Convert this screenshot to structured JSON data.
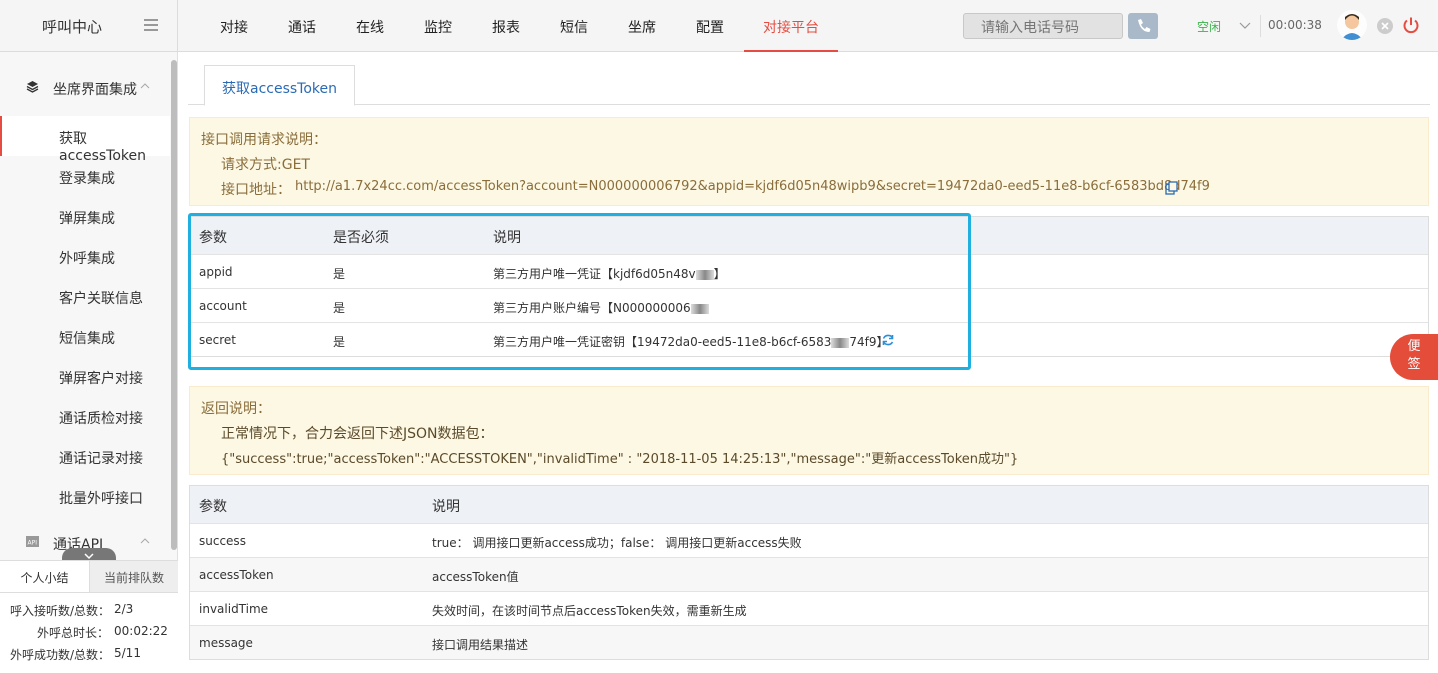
{
  "app": {
    "title": "呼叫中心"
  },
  "nav": {
    "items": [
      {
        "label": "对接"
      },
      {
        "label": "通话"
      },
      {
        "label": "在线"
      },
      {
        "label": "监控"
      },
      {
        "label": "报表"
      },
      {
        "label": "短信"
      },
      {
        "label": "坐席"
      },
      {
        "label": "配置"
      },
      {
        "label": "对接平台"
      }
    ],
    "active": "对接平台"
  },
  "header": {
    "phone_placeholder": "请输入电话号码",
    "status": "空闲",
    "timer": "00:00:38"
  },
  "sidebar": {
    "group1": "坐席界面集成",
    "items": [
      {
        "label": "获取accessToken"
      },
      {
        "label": "登录集成"
      },
      {
        "label": "弹屏集成"
      },
      {
        "label": "外呼集成"
      },
      {
        "label": "客户关联信息"
      },
      {
        "label": "短信集成"
      },
      {
        "label": "弹屏客户对接"
      },
      {
        "label": "通话质检对接"
      },
      {
        "label": "通话记录对接"
      },
      {
        "label": "批量外呼接口"
      }
    ],
    "group2": "通话API"
  },
  "summary": {
    "tabs": [
      "个人小结",
      "当前排队数"
    ],
    "rows": [
      {
        "label": "呼入接听数/总数：",
        "value": "2/3"
      },
      {
        "label": "外呼总时长：",
        "value": "00:02:22"
      },
      {
        "label": "外呼成功数/总数：",
        "value": "5/11"
      }
    ]
  },
  "main": {
    "tab": "获取accessToken",
    "request": {
      "title": "接口调用请求说明：",
      "method": "请求方式:GET",
      "url_label": "接口地址：",
      "url": "http://a1.7x24cc.com/accessToken?account=N000000006792&appid=kjdf6d05n48wipb9&secret=19472da0-eed5-11e8-b6cf-6583bd8d74f9"
    },
    "params": {
      "headers": [
        "参数",
        "是否必须",
        "说明"
      ],
      "rows": [
        {
          "name": "appid",
          "required": "是",
          "desc": "第三方用户唯一凭证【kjdf6d05n48v",
          "desc_end": "】"
        },
        {
          "name": "account",
          "required": "是",
          "desc": "第三方用户账户编号【N000000006",
          "desc_end": ""
        },
        {
          "name": "secret",
          "required": "是",
          "desc": "第三方用户唯一凭证密钥【19472da0-eed5-11e8-b6cf-6583",
          "desc_end": "74f9】"
        }
      ]
    },
    "response": {
      "title": "返回说明：",
      "desc": "正常情况下，合力会返回下述JSON数据包：",
      "json": "{\"success\":true;\"accessToken\":\"ACCESSTOKEN\",\"invalidTime\" : \"2018-11-05 14:25:13\",\"message\":\"更新accessToken成功\"}"
    },
    "fields": {
      "headers": [
        "参数",
        "说明"
      ],
      "rows": [
        {
          "name": "success",
          "desc": "true： 调用接口更新access成功；false： 调用接口更新access失败"
        },
        {
          "name": "accessToken",
          "desc": "accessToken值"
        },
        {
          "name": "invalidTime",
          "desc": "失效时间，在该时间节点后accessToken失效，需重新生成"
        },
        {
          "name": "message",
          "desc": "接口调用结果描述"
        }
      ]
    }
  },
  "sticky": {
    "line1": "便",
    "line2": "签"
  },
  "colors": {
    "accent": "#e54d42",
    "highlight": "#1fb0e0",
    "note_bg": "#fcf8e3",
    "note_text": "#8a6d3b"
  }
}
